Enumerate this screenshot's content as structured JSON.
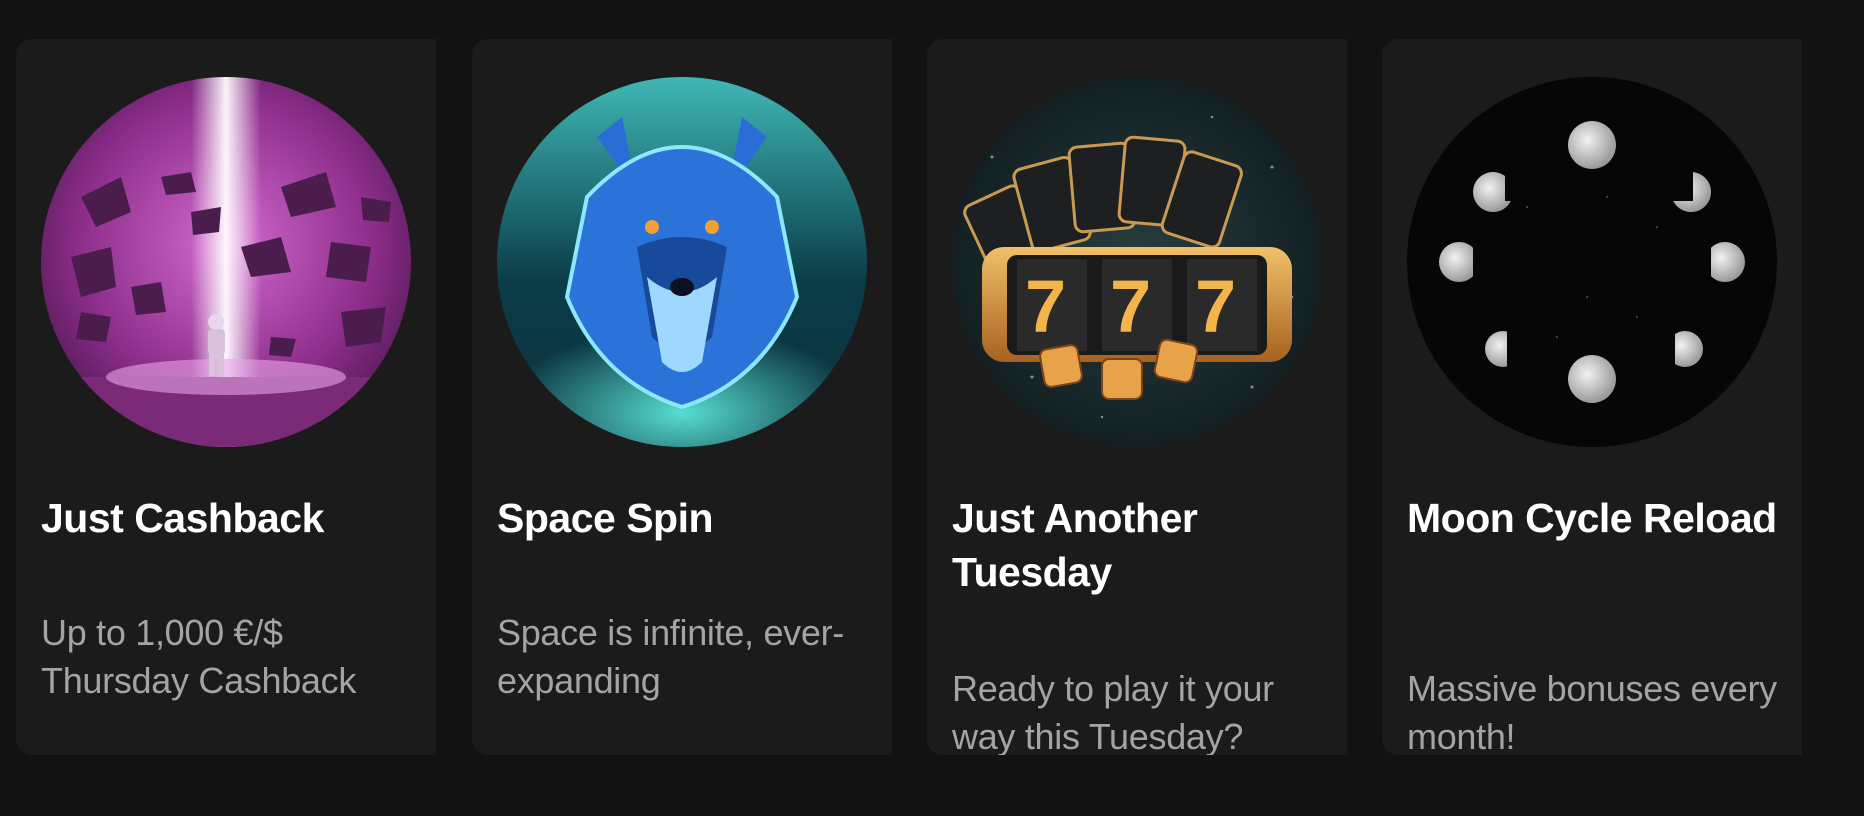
{
  "colors": {
    "page_background": "#121212",
    "card_background": "#1b1b1b",
    "title_text": "#ffffff",
    "description_text": "#a4a4a4"
  },
  "promotions": [
    {
      "title": "Just Cashback",
      "description": "Up to 1,000 €/$ Thursday Cashback",
      "image": "astronaut-light-beam-image"
    },
    {
      "title": "Space Spin",
      "description": "Space is infinite, ever-expanding",
      "image": "blue-wolf-image"
    },
    {
      "title": "Just Another Tuesday",
      "description": "Ready to play it your way this Tuesday?",
      "image": "slot-machine-777-image"
    },
    {
      "title": "Moon Cycle Reload",
      "description": "Massive bonuses every month!",
      "image": "moon-phases-image"
    }
  ]
}
